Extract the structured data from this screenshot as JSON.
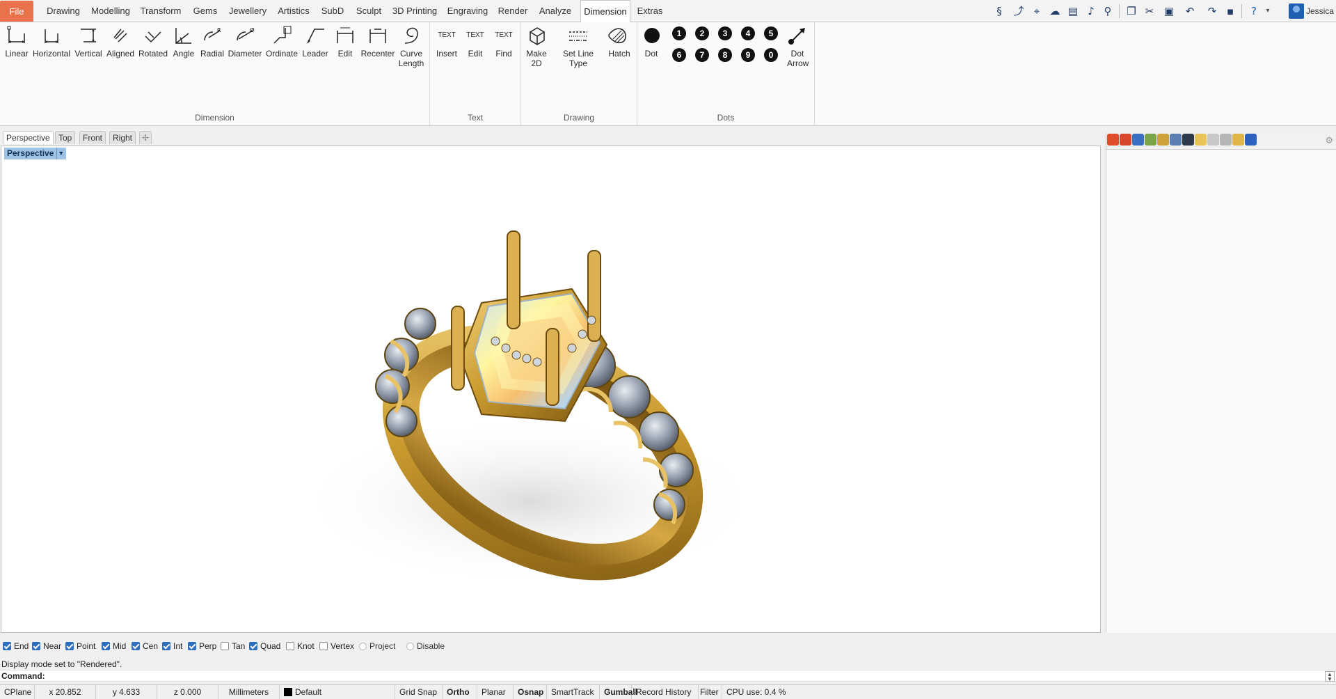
{
  "menu": {
    "items": [
      "File",
      "Drawing",
      "Modelling",
      "Transform",
      "Gems",
      "Jewellery",
      "Artistics",
      "SubD",
      "Sculpt",
      "3D Printing",
      "Engraving",
      "Render",
      "Analyze",
      "Dimension",
      "Extras"
    ],
    "active": "Dimension"
  },
  "quick_access_icons": [
    "script-icon",
    "curve-icon",
    "pin-icon",
    "cloud-icon",
    "clapper-icon",
    "microphone-icon",
    "zoom-icon",
    "copy-icon",
    "cut-icon",
    "paste-icon",
    "undo-icon",
    "redo-icon",
    "save-icon",
    "help-icon",
    "dropdown-icon"
  ],
  "user": {
    "name": "Jessica"
  },
  "ribbon": {
    "groups": [
      {
        "label": "Dimension",
        "buttons": [
          "Linear",
          "Horizontal",
          "Vertical",
          "Aligned",
          "Rotated",
          "Angle",
          "Radial",
          "Diameter",
          "Ordinate",
          "Leader",
          "Edit",
          "Recenter",
          "Curve Length"
        ]
      },
      {
        "label": "Text",
        "buttons": [
          "Insert",
          "Edit",
          "Find"
        ],
        "icon_text": [
          "TEXT",
          "TEXT",
          "TEXT"
        ]
      },
      {
        "label": "Drawing",
        "buttons": [
          "Make 2D",
          "Set Line Type",
          "Hatch"
        ]
      },
      {
        "label": "Dots",
        "buttons": [
          "Dot",
          "Dot Arrow"
        ],
        "numbers": [
          "1",
          "2",
          "3",
          "4",
          "5",
          "6",
          "7",
          "8",
          "9",
          "0"
        ]
      }
    ]
  },
  "viewport_tabs": [
    "Perspective",
    "Top",
    "Front",
    "Right"
  ],
  "viewport": {
    "title": "Perspective",
    "display_mode": "Rendered"
  },
  "osnap": {
    "items": [
      {
        "label": "End",
        "checked": true
      },
      {
        "label": "Near",
        "checked": true
      },
      {
        "label": "Point",
        "checked": true
      },
      {
        "label": "Mid",
        "checked": true
      },
      {
        "label": "Cen",
        "checked": true
      },
      {
        "label": "Int",
        "checked": true
      },
      {
        "label": "Perp",
        "checked": true
      },
      {
        "label": "Tan",
        "checked": false
      },
      {
        "label": "Quad",
        "checked": true
      },
      {
        "label": "Knot",
        "checked": false
      },
      {
        "label": "Vertex",
        "checked": false
      }
    ],
    "radio": [
      "Project",
      "Disable"
    ]
  },
  "command": {
    "history": "Display mode set to \"Rendered\".",
    "label": "Command:",
    "value": ""
  },
  "status": {
    "cplane": "CPlane",
    "x": "x 20.852",
    "y": "y 4.633",
    "z": "z 0.000",
    "units": "Millimeters",
    "layer": "Default",
    "toggles": [
      "Grid Snap",
      "Ortho",
      "Planar",
      "Osnap",
      "SmartTrack",
      "Gumball",
      "Record History",
      "Filter"
    ],
    "bold_toggles": [
      "Ortho",
      "Osnap",
      "Gumball"
    ],
    "cpu": "CPU use: 0.4 %"
  },
  "colors": {
    "file_tab": "#e8734a",
    "viewport_title": "#9fc3e5",
    "gold": "#c99a2e",
    "checkbox": "#2f6dbf"
  }
}
